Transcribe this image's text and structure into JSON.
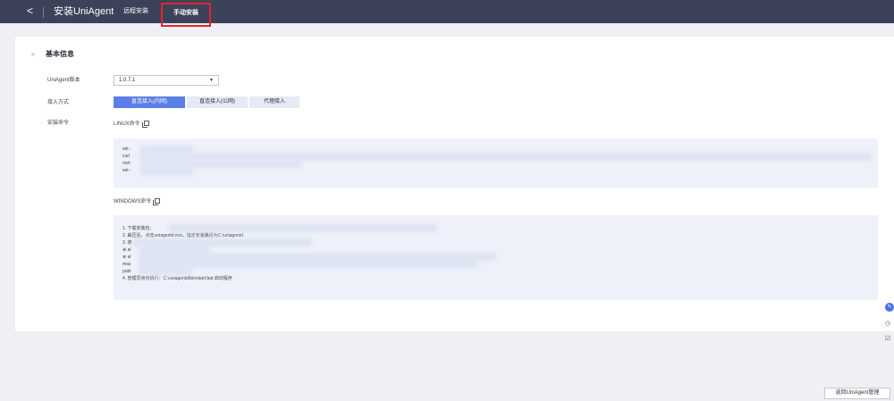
{
  "header": {
    "back_glyph": "<",
    "title": "安装UniAgent",
    "tabs": [
      {
        "label": "远程安装",
        "active": false
      },
      {
        "label": "手动安装",
        "active": true
      }
    ]
  },
  "section": {
    "title": "基本信息"
  },
  "form": {
    "version_label": "UniAgent版本",
    "version_value": "1.0.7.1",
    "access_label": "接入方式",
    "access_modes": [
      {
        "label": "直连接入(内网)",
        "active": true
      },
      {
        "label": "直连接入(公网)",
        "active": false
      },
      {
        "label": "代理接入",
        "active": false
      }
    ],
    "install_label": "安装命令"
  },
  "linux": {
    "heading": "LINUX命令",
    "lines": [
      "set -",
      "curl",
      "nort",
      "set -"
    ]
  },
  "windows": {
    "heading": "WINDOWS命令",
    "lines": [
      "1. 下载安装包：",
      "2. 解压后，点击uniagentd.msi，指定安装路径为C:\\uniagentd",
      "3. 修",
      "⊕ al",
      "⊕ al",
      "mas",
      "publ",
      "4. 管理员身份执行：C:\\uniagentd\\bin\\start.bat 启动程序"
    ]
  },
  "footer": {
    "return_button": "返回UniAgent管理"
  },
  "colors": {
    "topbar": "#3b4259",
    "accent": "#5a7fe6",
    "highlight_border": "#e0262d",
    "code_bg": "#eef1fa"
  },
  "icons": {
    "back": "chevron-left-icon",
    "copy": "copy-icon",
    "chat": "chat-icon",
    "clock": "clock-icon",
    "edit": "edit-icon"
  }
}
